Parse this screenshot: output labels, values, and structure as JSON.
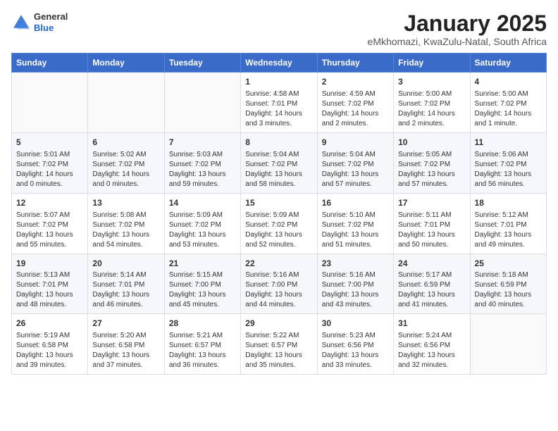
{
  "header": {
    "logo_general": "General",
    "logo_blue": "Blue",
    "main_title": "January 2025",
    "subtitle": "eMkhomazi, KwaZulu-Natal, South Africa"
  },
  "columns": [
    "Sunday",
    "Monday",
    "Tuesday",
    "Wednesday",
    "Thursday",
    "Friday",
    "Saturday"
  ],
  "weeks": [
    [
      {
        "day": "",
        "info": ""
      },
      {
        "day": "",
        "info": ""
      },
      {
        "day": "",
        "info": ""
      },
      {
        "day": "1",
        "info": "Sunrise: 4:58 AM\nSunset: 7:01 PM\nDaylight: 14 hours\nand 3 minutes."
      },
      {
        "day": "2",
        "info": "Sunrise: 4:59 AM\nSunset: 7:02 PM\nDaylight: 14 hours\nand 2 minutes."
      },
      {
        "day": "3",
        "info": "Sunrise: 5:00 AM\nSunset: 7:02 PM\nDaylight: 14 hours\nand 2 minutes."
      },
      {
        "day": "4",
        "info": "Sunrise: 5:00 AM\nSunset: 7:02 PM\nDaylight: 14 hours\nand 1 minute."
      }
    ],
    [
      {
        "day": "5",
        "info": "Sunrise: 5:01 AM\nSunset: 7:02 PM\nDaylight: 14 hours\nand 0 minutes."
      },
      {
        "day": "6",
        "info": "Sunrise: 5:02 AM\nSunset: 7:02 PM\nDaylight: 14 hours\nand 0 minutes."
      },
      {
        "day": "7",
        "info": "Sunrise: 5:03 AM\nSunset: 7:02 PM\nDaylight: 13 hours\nand 59 minutes."
      },
      {
        "day": "8",
        "info": "Sunrise: 5:04 AM\nSunset: 7:02 PM\nDaylight: 13 hours\nand 58 minutes."
      },
      {
        "day": "9",
        "info": "Sunrise: 5:04 AM\nSunset: 7:02 PM\nDaylight: 13 hours\nand 57 minutes."
      },
      {
        "day": "10",
        "info": "Sunrise: 5:05 AM\nSunset: 7:02 PM\nDaylight: 13 hours\nand 57 minutes."
      },
      {
        "day": "11",
        "info": "Sunrise: 5:06 AM\nSunset: 7:02 PM\nDaylight: 13 hours\nand 56 minutes."
      }
    ],
    [
      {
        "day": "12",
        "info": "Sunrise: 5:07 AM\nSunset: 7:02 PM\nDaylight: 13 hours\nand 55 minutes."
      },
      {
        "day": "13",
        "info": "Sunrise: 5:08 AM\nSunset: 7:02 PM\nDaylight: 13 hours\nand 54 minutes."
      },
      {
        "day": "14",
        "info": "Sunrise: 5:09 AM\nSunset: 7:02 PM\nDaylight: 13 hours\nand 53 minutes."
      },
      {
        "day": "15",
        "info": "Sunrise: 5:09 AM\nSunset: 7:02 PM\nDaylight: 13 hours\nand 52 minutes."
      },
      {
        "day": "16",
        "info": "Sunrise: 5:10 AM\nSunset: 7:02 PM\nDaylight: 13 hours\nand 51 minutes."
      },
      {
        "day": "17",
        "info": "Sunrise: 5:11 AM\nSunset: 7:01 PM\nDaylight: 13 hours\nand 50 minutes."
      },
      {
        "day": "18",
        "info": "Sunrise: 5:12 AM\nSunset: 7:01 PM\nDaylight: 13 hours\nand 49 minutes."
      }
    ],
    [
      {
        "day": "19",
        "info": "Sunrise: 5:13 AM\nSunset: 7:01 PM\nDaylight: 13 hours\nand 48 minutes."
      },
      {
        "day": "20",
        "info": "Sunrise: 5:14 AM\nSunset: 7:01 PM\nDaylight: 13 hours\nand 46 minutes."
      },
      {
        "day": "21",
        "info": "Sunrise: 5:15 AM\nSunset: 7:00 PM\nDaylight: 13 hours\nand 45 minutes."
      },
      {
        "day": "22",
        "info": "Sunrise: 5:16 AM\nSunset: 7:00 PM\nDaylight: 13 hours\nand 44 minutes."
      },
      {
        "day": "23",
        "info": "Sunrise: 5:16 AM\nSunset: 7:00 PM\nDaylight: 13 hours\nand 43 minutes."
      },
      {
        "day": "24",
        "info": "Sunrise: 5:17 AM\nSunset: 6:59 PM\nDaylight: 13 hours\nand 41 minutes."
      },
      {
        "day": "25",
        "info": "Sunrise: 5:18 AM\nSunset: 6:59 PM\nDaylight: 13 hours\nand 40 minutes."
      }
    ],
    [
      {
        "day": "26",
        "info": "Sunrise: 5:19 AM\nSunset: 6:58 PM\nDaylight: 13 hours\nand 39 minutes."
      },
      {
        "day": "27",
        "info": "Sunrise: 5:20 AM\nSunset: 6:58 PM\nDaylight: 13 hours\nand 37 minutes."
      },
      {
        "day": "28",
        "info": "Sunrise: 5:21 AM\nSunset: 6:57 PM\nDaylight: 13 hours\nand 36 minutes."
      },
      {
        "day": "29",
        "info": "Sunrise: 5:22 AM\nSunset: 6:57 PM\nDaylight: 13 hours\nand 35 minutes."
      },
      {
        "day": "30",
        "info": "Sunrise: 5:23 AM\nSunset: 6:56 PM\nDaylight: 13 hours\nand 33 minutes."
      },
      {
        "day": "31",
        "info": "Sunrise: 5:24 AM\nSunset: 6:56 PM\nDaylight: 13 hours\nand 32 minutes."
      },
      {
        "day": "",
        "info": ""
      }
    ]
  ]
}
